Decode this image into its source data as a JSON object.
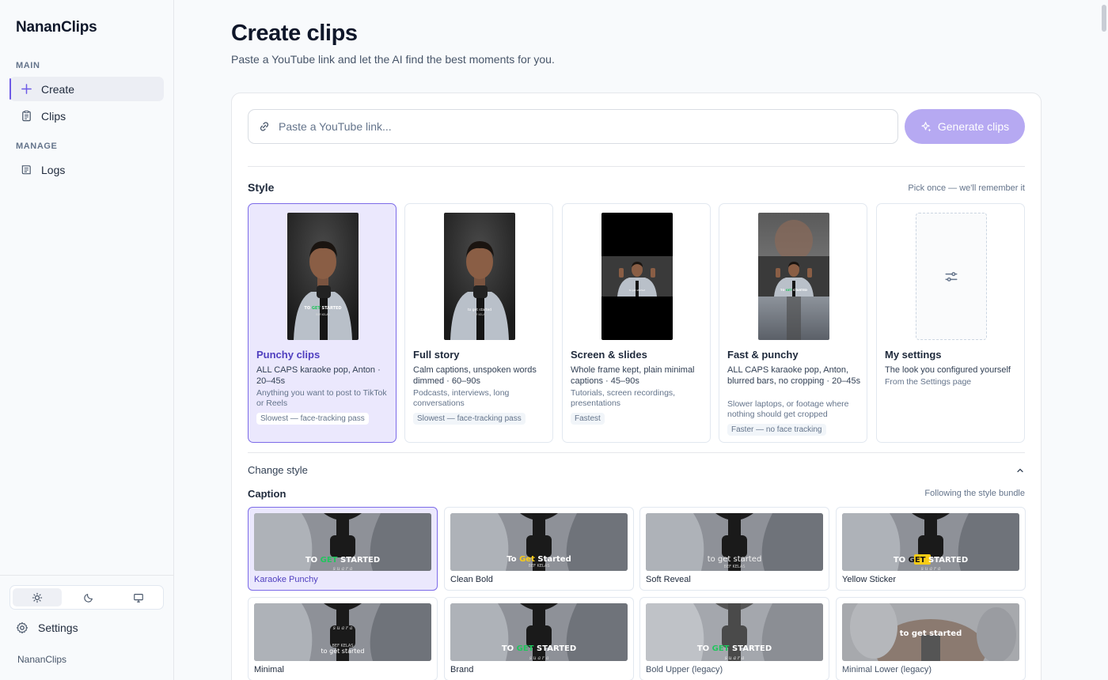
{
  "sidebar": {
    "brand": "NananClips",
    "sections": [
      {
        "label": "MAIN",
        "items": [
          {
            "label": "Create",
            "icon": "plus-icon",
            "active": true
          },
          {
            "label": "Clips",
            "icon": "clipboard-icon",
            "active": false
          }
        ]
      },
      {
        "label": "MANAGE",
        "items": [
          {
            "label": "Logs",
            "icon": "logs-icon",
            "active": false
          }
        ]
      }
    ],
    "theme_options": [
      "light",
      "dark",
      "system"
    ],
    "theme_selected": "light",
    "settings_label": "Settings",
    "footer": "NananClips"
  },
  "main": {
    "title": "Create clips",
    "subtitle": "Paste a YouTube link and let the AI find the best moments for you.",
    "url_input": {
      "placeholder": "Paste a YouTube link...",
      "value": ""
    },
    "generate_button": "Generate clips",
    "style_section": {
      "title": "Style",
      "hint": "Pick once — we'll remember it",
      "cards": [
        {
          "title": "Punchy clips",
          "desc": "ALL CAPS karaoke pop, Anton · 20–45s",
          "use": "Anything you want to post to TikTok or Reels",
          "badge": "Slowest — face-tracking pass",
          "selected": true
        },
        {
          "title": "Full story",
          "desc": "Calm captions, unspoken words dimmed · 60–90s",
          "use": "Podcasts, interviews, long conversations",
          "badge": "Slowest — face-tracking pass",
          "selected": false
        },
        {
          "title": "Screen & slides",
          "desc": "Whole frame kept, plain minimal captions · 45–90s",
          "use": "Tutorials, screen recordings, presentations",
          "badge": "Fastest",
          "selected": false
        },
        {
          "title": "Fast & punchy",
          "desc": "ALL CAPS karaoke pop, Anton, blurred bars, no cropping · 20–45s",
          "use": "Slower laptops, or footage where nothing should get cropped",
          "badge": "Faster — no face tracking",
          "selected": false
        },
        {
          "title": "My settings",
          "desc": "The look you configured yourself",
          "use": "From the Settings page",
          "badge": "",
          "selected": false
        }
      ]
    },
    "change_style_label": "Change style",
    "caption_section": {
      "title": "Caption",
      "hint": "Following the style bundle",
      "styles": [
        {
          "label": "Karaoke Punchy",
          "overlay": [
            "TO ",
            "GET",
            " STARTED"
          ],
          "selected": true
        },
        {
          "label": "Clean Bold",
          "overlay": [
            "To ",
            "Get",
            " Started"
          ],
          "selected": false
        },
        {
          "label": "Soft Reveal",
          "overlay": [
            "to get started"
          ],
          "selected": false
        },
        {
          "label": "Yellow Sticker",
          "overlay": [
            "TO ",
            "GET",
            " STARTED"
          ],
          "selected": false
        },
        {
          "label": "Minimal",
          "overlay": [
            "to get started"
          ],
          "selected": false
        },
        {
          "label": "Brand",
          "overlay": [
            "TO ",
            "GET",
            " STARTED"
          ],
          "selected": false
        },
        {
          "label": "Bold Upper (legacy)",
          "overlay": [
            "TO ",
            "GET",
            " STARTED"
          ],
          "selected": false
        },
        {
          "label": "Minimal Lower (legacy)",
          "overlay": [
            "to get started"
          ],
          "selected": false
        }
      ]
    }
  },
  "colors": {
    "accent": "#6d5ae6",
    "accent_soft": "#ebe8fd",
    "button_disabled": "#b6a9f2",
    "highlight_green": "#22c55e",
    "highlight_yellow": "#facc15"
  }
}
